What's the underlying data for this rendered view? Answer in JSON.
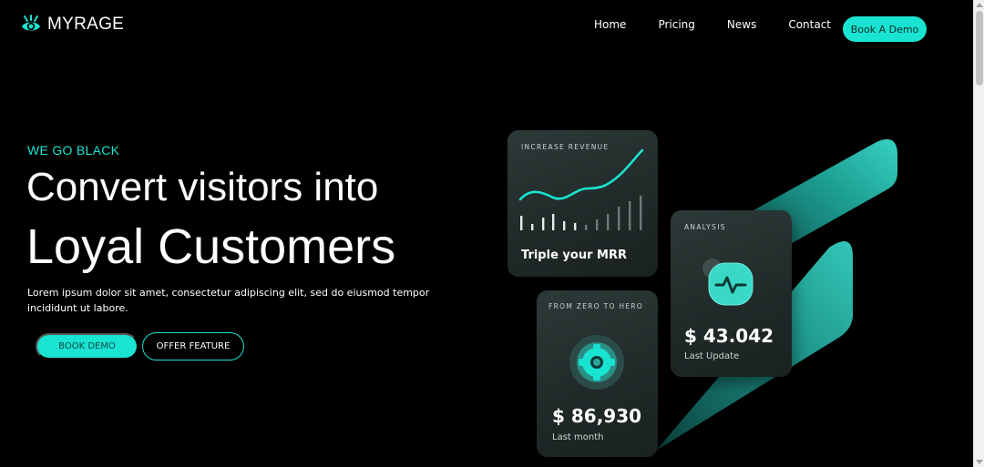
{
  "brand": {
    "name": "MYRAGE",
    "accent": "#19e3d1"
  },
  "nav": {
    "items": [
      {
        "label": "Home"
      },
      {
        "label": "Pricing"
      },
      {
        "label": "News"
      },
      {
        "label": "Contact"
      }
    ],
    "cta_label": "Book A Demo"
  },
  "hero": {
    "eyebrow": "WE GO BLACK",
    "title_line1": "Convert visitors into",
    "title_line2": "Loyal Customers",
    "lede": "Lorem ipsum dolor sit amet, consectetur adipiscing elit, sed do eiusmod tempor incididunt ut labore.",
    "primary_button": "BOOK DEMO",
    "secondary_button": "OFFER FEATURE"
  },
  "cards": {
    "revenue": {
      "label": "INCREASE REVENUE",
      "title": "Triple your MRR"
    },
    "analysis": {
      "label": "ANALYSIS",
      "value": "$ 43.042",
      "caption": "Last Update",
      "icon": "pulse-icon"
    },
    "hero": {
      "label": "FROM ZERO TO HERO",
      "value": "$ 86,930",
      "caption": "Last month",
      "icon": "gear-icon"
    }
  }
}
